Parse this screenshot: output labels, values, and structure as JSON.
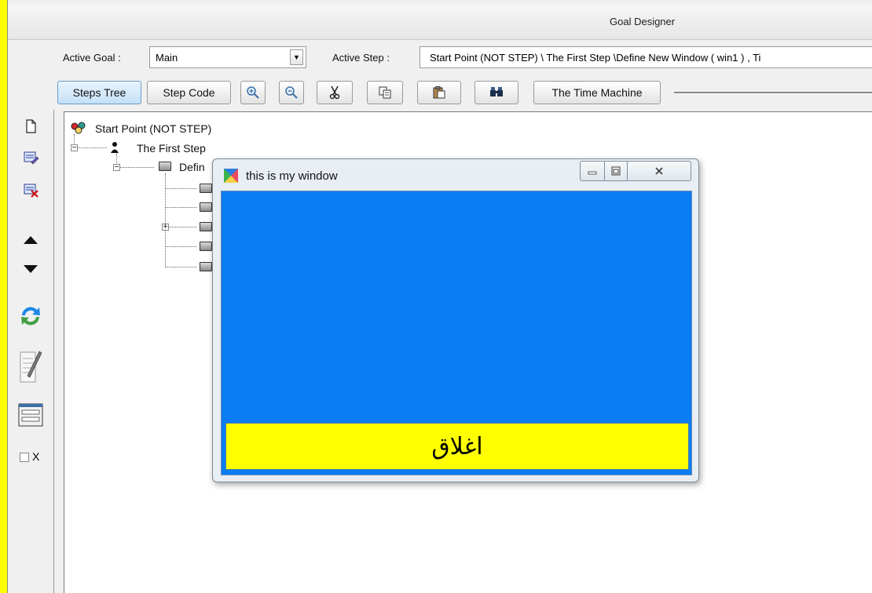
{
  "window": {
    "title": "Goal Designer"
  },
  "toolbar": {
    "active_goal_label": "Active Goal :",
    "active_goal_value": "Main",
    "active_step_label": "Active Step :",
    "active_step_value": "Start Point (NOT STEP) \\ The First Step  \\Define New Window  ( win1 ) , Ti"
  },
  "buttons": {
    "steps_tree": "Steps Tree",
    "step_code": "Step Code",
    "time_machine": "The Time Machine"
  },
  "tree": {
    "root": "Start Point (NOT STEP)",
    "first_step": "The First Step",
    "define_truncated": "Defin"
  },
  "sidebar": {
    "checkbox_label": "X"
  },
  "child_window": {
    "title": "this is my window",
    "close_button_text": "اغلاق"
  },
  "colors": {
    "background_yellow": "#ffff00",
    "client_blue": "#0a7df2",
    "button_yellow": "#ffff00"
  }
}
